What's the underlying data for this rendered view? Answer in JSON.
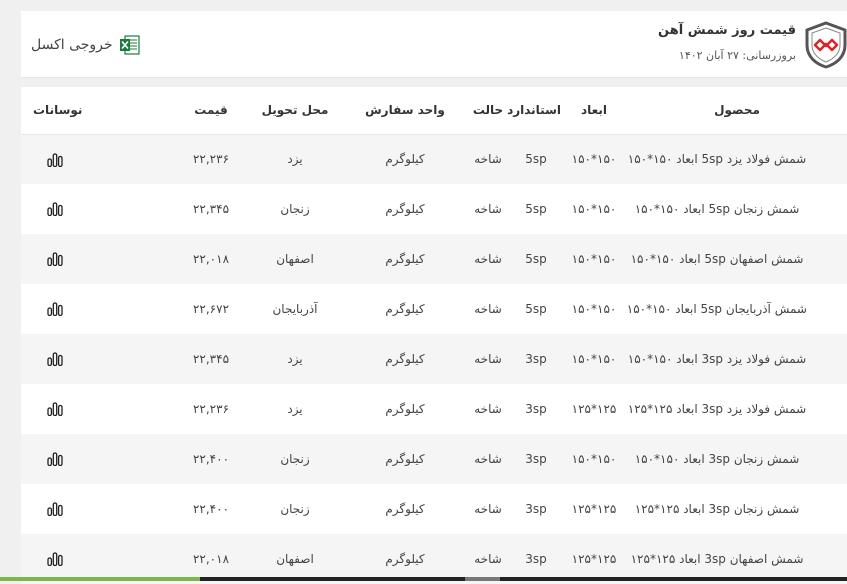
{
  "header": {
    "title": "قیمت روز شمش آهن",
    "updated": "بروزرسانی: ۲۷ آبان ۱۴۰۲",
    "excel_label": "خروجی اکسل",
    "excel_icon": "excel-icon",
    "logo_icon": "shield-logo-icon"
  },
  "colors": {
    "brand_red": "#d9252a",
    "brand_grey": "#555555",
    "excel_green": "#1d7a3e"
  },
  "table": {
    "columns": [
      "محصول",
      "ابعاد",
      "استاندارد",
      "حالت",
      "واحد سفارش",
      "محل تحویل",
      "قیمت",
      "نوسانات"
    ],
    "rows": [
      {
        "product": "شمش فولاد یزد 5sp ابعاد ۱۵۰*۱۵۰",
        "dims": "۱۵۰*۱۵۰",
        "standard": "5sp",
        "state": "شاخه",
        "unit": "کیلوگرم",
        "place": "یزد",
        "price": "۲۲,۲۳۶"
      },
      {
        "product": "شمش زنجان 5sp ابعاد ۱۵۰*۱۵۰",
        "dims": "۱۵۰*۱۵۰",
        "standard": "5sp",
        "state": "شاخه",
        "unit": "کیلوگرم",
        "place": "زنجان",
        "price": "۲۲,۳۴۵"
      },
      {
        "product": "شمش اصفهان 5sp ابعاد ۱۵۰*۱۵۰",
        "dims": "۱۵۰*۱۵۰",
        "standard": "5sp",
        "state": "شاخه",
        "unit": "کیلوگرم",
        "place": "اصفهان",
        "price": "۲۲,۰۱۸"
      },
      {
        "product": "شمش آذربایجان 5sp ابعاد ۱۵۰*۱۵۰",
        "dims": "۱۵۰*۱۵۰",
        "standard": "5sp",
        "state": "شاخه",
        "unit": "کیلوگرم",
        "place": "آذربایجان",
        "price": "۲۲,۶۷۲"
      },
      {
        "product": "شمش فولاد یزد 3sp ابعاد ۱۵۰*۱۵۰",
        "dims": "۱۵۰*۱۵۰",
        "standard": "3sp",
        "state": "شاخه",
        "unit": "کیلوگرم",
        "place": "یزد",
        "price": "۲۲,۳۴۵"
      },
      {
        "product": "شمش فولاد یزد 3sp ابعاد ۱۲۵*۱۲۵",
        "dims": "۱۲۵*۱۲۵",
        "standard": "3sp",
        "state": "شاخه",
        "unit": "کیلوگرم",
        "place": "یزد",
        "price": "۲۲,۲۳۶"
      },
      {
        "product": "شمش زنجان 3sp ابعاد ۱۵۰*۱۵۰",
        "dims": "۱۵۰*۱۵۰",
        "standard": "3sp",
        "state": "شاخه",
        "unit": "کیلوگرم",
        "place": "زنجان",
        "price": "۲۲,۴۰۰"
      },
      {
        "product": "شمش زنجان 3sp ابعاد ۱۲۵*۱۲۵",
        "dims": "۱۲۵*۱۲۵",
        "standard": "3sp",
        "state": "شاخه",
        "unit": "کیلوگرم",
        "place": "زنجان",
        "price": "۲۲,۴۰۰"
      },
      {
        "product": "شمش اصفهان 3sp ابعاد ۱۲۵*۱۲۵",
        "dims": "۱۲۵*۱۲۵",
        "standard": "3sp",
        "state": "شاخه",
        "unit": "کیلوگرم",
        "place": "اصفهان",
        "price": "۲۲,۰۱۸"
      }
    ],
    "fluctuation_icon": "bar-chart-icon"
  }
}
